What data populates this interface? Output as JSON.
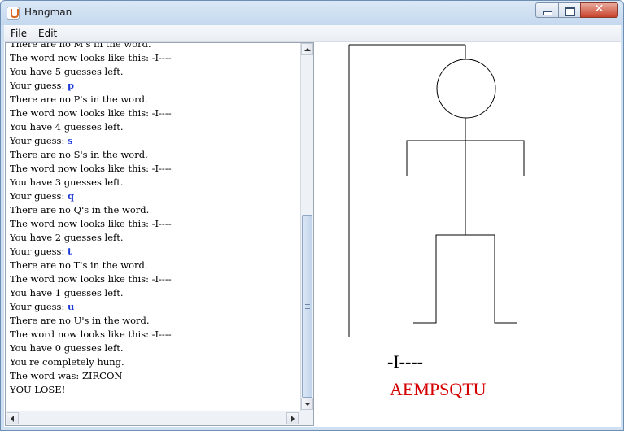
{
  "window": {
    "title": "Hangman"
  },
  "menu": {
    "items": [
      "File",
      "Edit"
    ]
  },
  "log": {
    "lines": [
      {
        "text": "There are no M's in the word."
      },
      {
        "text": "The word now looks like this: -I----"
      },
      {
        "text": "You have 5 guesses left."
      },
      {
        "text": "Your guess: ",
        "guess": "p"
      },
      {
        "text": "There are no P's in the word."
      },
      {
        "text": "The word now looks like this: -I----"
      },
      {
        "text": "You have 4 guesses left."
      },
      {
        "text": "Your guess: ",
        "guess": "s"
      },
      {
        "text": "There are no S's in the word."
      },
      {
        "text": "The word now looks like this: -I----"
      },
      {
        "text": "You have 3 guesses left."
      },
      {
        "text": "Your guess: ",
        "guess": "q"
      },
      {
        "text": "There are no Q's in the word."
      },
      {
        "text": "The word now looks like this: -I----"
      },
      {
        "text": "You have 2 guesses left."
      },
      {
        "text": "Your guess: ",
        "guess": "t"
      },
      {
        "text": "There are no T's in the word."
      },
      {
        "text": "The word now looks like this: -I----"
      },
      {
        "text": "You have 1 guesses left."
      },
      {
        "text": "Your guess: ",
        "guess": "u"
      },
      {
        "text": "There are no U's in the word."
      },
      {
        "text": "The word now looks like this: -I----"
      },
      {
        "text": "You have 0 guesses left."
      },
      {
        "text": "You're completely hung."
      },
      {
        "text": "The word was: ZIRCON"
      },
      {
        "text": "YOU LOSE!"
      }
    ],
    "guess_color": "#1d3ad6"
  },
  "game": {
    "pattern": "-I----",
    "used_letters": "AEMPSQTU",
    "used_letters_color": "#d40000"
  }
}
